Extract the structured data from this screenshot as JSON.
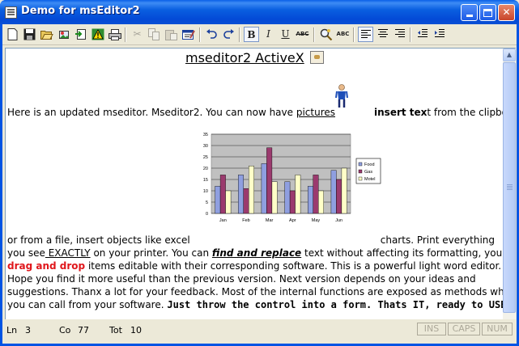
{
  "window": {
    "title": "Demo for msEditor2"
  },
  "toolbar": {
    "buttons": [
      {
        "name": "new-document-icon"
      },
      {
        "name": "save-icon"
      },
      {
        "name": "open-folder-icon"
      },
      {
        "name": "insert-picture-icon"
      },
      {
        "name": "insert-object-icon"
      },
      {
        "name": "warning-icon"
      },
      {
        "name": "print-icon"
      },
      {
        "name": "cut-icon"
      },
      {
        "name": "copy-icon"
      },
      {
        "name": "paste-icon"
      },
      {
        "name": "edit-object-icon"
      },
      {
        "name": "undo-icon"
      },
      {
        "name": "redo-icon"
      },
      {
        "name": "find-icon"
      },
      {
        "name": "align-left-icon"
      },
      {
        "name": "align-center-icon"
      },
      {
        "name": "align-right-icon"
      },
      {
        "name": "outdent-icon"
      },
      {
        "name": "indent-icon"
      }
    ],
    "bold_label": "B",
    "italic_label": "I",
    "underline_label": "U",
    "strike_label": "ABC",
    "spell_label": "ABC"
  },
  "document": {
    "heading": "mseditor2 ActiveX",
    "line1": {
      "a": "Here is an updated mseditor. Mseditor2. You can now have ",
      "pictures": "pictures",
      "insert_text": "insert tex",
      "b": "t from the clipboard"
    },
    "line2": {
      "a": "or from a file, insert objects like excel",
      "b": "charts. Print everything"
    },
    "line3": {
      "a": "you see",
      "exactly": " EXACTLY",
      "b": " on your printer. You can ",
      "find_replace": "find and replace",
      "c": " text without affecting its formatting, you can"
    },
    "line4": {
      "drag_drop": "drag and drop",
      "b": " items editable with their corresponding software. This is a powerful light word editor."
    },
    "line5": "Hope you find it more useful than the previous version. Next version depends on your ideas and",
    "line6": "suggestions. Thanx a lot for your feedback. Most of the internal functions are exposed as methods which",
    "line7": {
      "a": "you can call from your software. ",
      "bold": "Just throw the control into a form. Thats IT, ready to USE:)."
    }
  },
  "chart_data": {
    "type": "bar",
    "categories": [
      "Jan",
      "Feb",
      "Mar",
      "Apr",
      "May",
      "Jun"
    ],
    "series": [
      {
        "name": "Food",
        "color": "#8f9fe0",
        "values": [
          12,
          17,
          22,
          14,
          12,
          19
        ]
      },
      {
        "name": "Gas",
        "color": "#9b3a6e",
        "values": [
          17,
          11,
          29,
          10,
          17,
          15
        ]
      },
      {
        "name": "Motel",
        "color": "#ffffc8",
        "values": [
          10,
          21,
          14,
          17,
          10,
          20
        ]
      }
    ],
    "ylim": [
      0,
      35
    ],
    "yticks": [
      "0",
      "5",
      "10",
      "15",
      "20",
      "25",
      "30",
      "35"
    ],
    "grid": true,
    "plot_background": "#c0c0c0",
    "legend": "right"
  },
  "status": {
    "ln_label": "Ln",
    "ln_value": "3",
    "co_label": "Co",
    "co_value": "77",
    "tot_label": "Tot",
    "tot_value": "10",
    "ins": "INS",
    "caps": "CAPS",
    "num": "NUM"
  }
}
